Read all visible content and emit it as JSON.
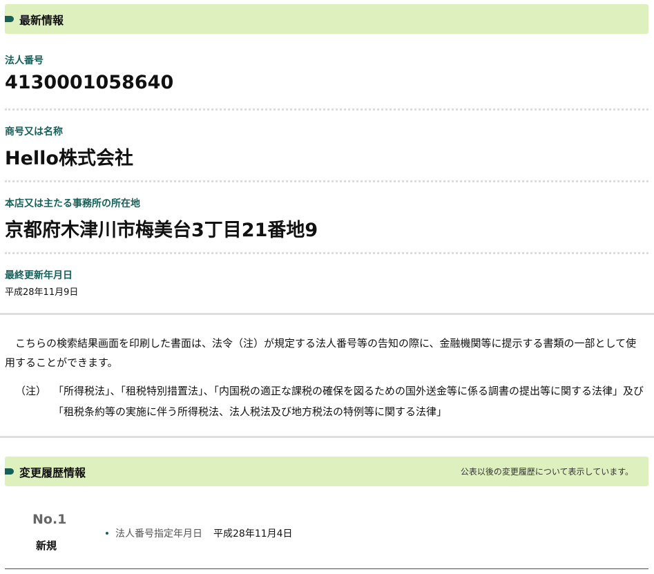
{
  "latest": {
    "header": "最新情報",
    "corp_number_label": "法人番号",
    "corp_number_value": "4130001058640",
    "name_label": "商号又は名称",
    "name_value": "Hello株式会社",
    "address_label": "本店又は主たる事務所の所在地",
    "address_value": "京都府木津川市梅美台3丁目21番地9",
    "updated_label": "最終更新年月日",
    "updated_value": "平成28年11月9日"
  },
  "notice": {
    "paragraph": "　こちらの検索結果画面を印刷した書面は、法令（注）が規定する法人番号等の告知の際に、金融機関等に提示する書類の一部として使用することができます。",
    "note_mark": "（注）",
    "note_text": "「所得税法」、「租税特別措置法」、「内国税の適正な課税の確保を図るための国外送金等に係る調書の提出等に関する法律」及び「租税条約等の実施に伴う所得税法、法人税法及び地方税法の特例等に関する法律」"
  },
  "history": {
    "header": "変更履歴情報",
    "header_note": "公表以後の変更履歴について表示しています。",
    "entries": [
      {
        "no": "No.1",
        "kind": "新規",
        "item_label": "法人番号指定年月日",
        "item_value": "平成28年11月4日"
      }
    ]
  }
}
